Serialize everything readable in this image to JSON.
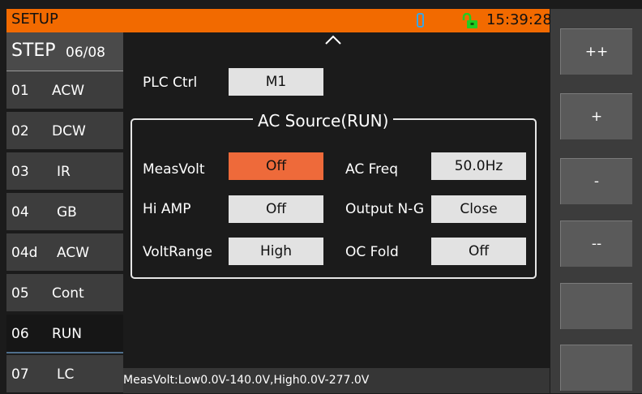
{
  "header": {
    "title": "SETUP",
    "time": "15:39:28",
    "icons": [
      "usb-icon",
      "unlock-icon"
    ]
  },
  "steps": {
    "header_main": "STEP",
    "header_index": "06/08",
    "items": [
      {
        "num": "01",
        "mode": "ACW"
      },
      {
        "num": "02",
        "mode": "DCW"
      },
      {
        "num": "03",
        "mode": "IR"
      },
      {
        "num": "04",
        "mode": "GB"
      },
      {
        "num": "04d",
        "mode": "ACW"
      },
      {
        "num": "05",
        "mode": "Cont"
      },
      {
        "num": "06",
        "mode": "RUN"
      },
      {
        "num": "07",
        "mode": "LC"
      }
    ],
    "active_index": 6
  },
  "main": {
    "plc_label": "PLC Ctrl",
    "plc_value": "M1",
    "group_title": "AC Source(RUN)",
    "fields": {
      "meas_volt_label": "MeasVolt",
      "meas_volt_value": "Off",
      "hi_amp_label": "Hi AMP",
      "hi_amp_value": "Off",
      "volt_range_label": "VoltRange",
      "volt_range_value": "High",
      "ac_freq_label": "AC Freq",
      "ac_freq_value": "50.0Hz",
      "output_ng_label": "Output N-G",
      "output_ng_value": "Close",
      "oc_fold_label": "OC Fold",
      "oc_fold_value": "Off"
    },
    "status_text": "MeasVolt:Low0.0V-140.0V,High0.0V-277.0V"
  },
  "side_buttons": [
    "++",
    "+",
    "-",
    "--",
    "",
    ""
  ],
  "colors": {
    "accent": "#f26a00",
    "selected_button": "#ee6a3a",
    "lock_icon": "#22cc22",
    "usb_icon": "#39a6e6"
  }
}
